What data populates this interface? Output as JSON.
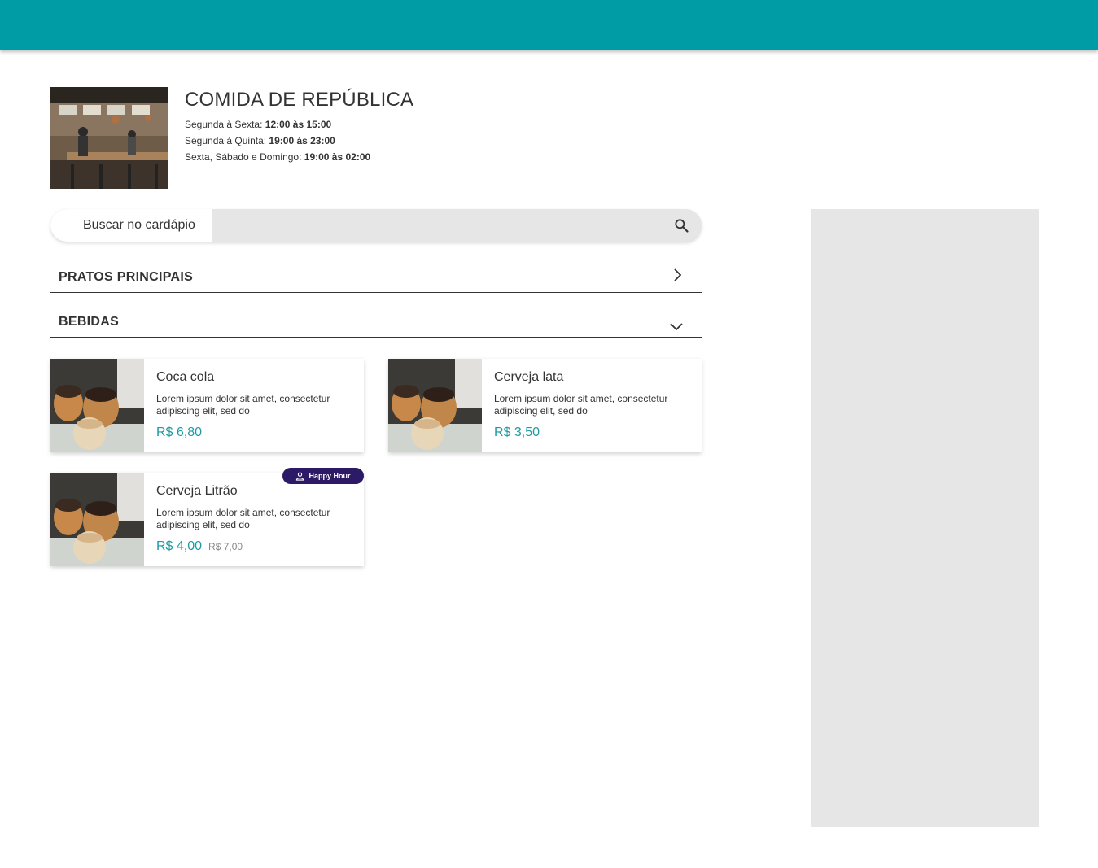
{
  "restaurant": {
    "name": "COMIDA DE REPÚBLICA",
    "hours": [
      {
        "label": "Segunda à Sexta:",
        "time": "12:00 às 15:00"
      },
      {
        "label": "Segunda à Quinta:",
        "time": "19:00 às 23:00"
      },
      {
        "label": "Sexta, Sábado e Domingo:",
        "time": "19:00 às 02:00"
      }
    ]
  },
  "search": {
    "label": "Buscar no cardápio",
    "value": "",
    "icon": "search-icon"
  },
  "categories": [
    {
      "title": "PRATOS PRINCIPAIS",
      "state": "collapsed",
      "icon": "chevron-right-icon"
    },
    {
      "title": "BEBIDAS",
      "state": "expanded",
      "icon": "chevron-down-icon"
    }
  ],
  "products": [
    {
      "name": "Coca cola",
      "description": "Lorem ipsum dolor sit amet, consectetur adipiscing elit, sed do",
      "price": "R$ 6,80"
    },
    {
      "name": "Cerveja lata",
      "description": "Lorem ipsum dolor sit amet, consectetur adipiscing elit, sed do",
      "price": "R$ 3,50"
    },
    {
      "name": "Cerveja Litrão",
      "description": "Lorem ipsum dolor sit amet, consectetur adipiscing elit, sed do",
      "price": "R$ 4,00",
      "old_price": "R$ 7,00",
      "badge": "Happy Hour"
    }
  ],
  "colors": {
    "header": "#009ca6",
    "price": "#1a9ba3",
    "badge": "#2c1a66",
    "sidebar": "#e6e6e6"
  }
}
